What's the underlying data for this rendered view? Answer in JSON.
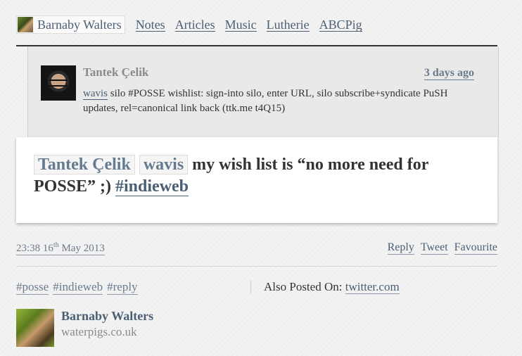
{
  "nav": {
    "brand": "Barnaby Walters",
    "items": [
      "Notes",
      "Articles",
      "Music",
      "Lutherie",
      "ABCPig"
    ]
  },
  "quote": {
    "author": "Tantek Çelik",
    "time": "3 days ago",
    "mention": "wavis",
    "text": "silo #POSSE wishlist: sign-into silo, enter URL, silo subscribe+syndicate PuSH updates, rel=canonical link back (ttk.me t4Q15)"
  },
  "note": {
    "mention1": "Tantek Çelik",
    "mention2": "wavis",
    "text": "my wish list is “no more need for POSSE” ;)",
    "hashtag": "#indieweb"
  },
  "meta": {
    "time": "23:38 16",
    "day_suffix": "th",
    "month_year": "May 2013",
    "actions": [
      "Reply",
      "Tweet",
      "Favourite"
    ]
  },
  "tags": [
    "#posse",
    "#indieweb",
    "#reply"
  ],
  "also_posted": {
    "label": "Also Posted On:",
    "link": "twitter.com"
  },
  "author": {
    "name": "Barnaby Walters",
    "site": "waterpigs.co.uk"
  },
  "colors": {
    "link": "#4b5f74",
    "background": "#f3f3f3",
    "card": "#ffffff"
  }
}
